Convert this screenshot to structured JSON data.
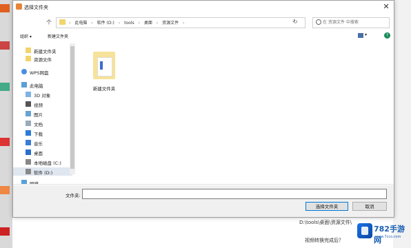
{
  "dialog": {
    "title": "选择文件夹",
    "close_glyph": "✕",
    "nav": {
      "up_glyph": "个",
      "breadcrumbs": [
        "此电脑",
        "软件 (D:)",
        "tools",
        "桌面",
        "资源文件"
      ],
      "separator": "›",
      "dropdown_glyph": "⌄",
      "refresh_glyph": "↻",
      "search_placeholder": "在 资源文件 中搜索"
    },
    "toolbar": {
      "organize_label": "组织 ▾",
      "new_folder_label": "新建文件夹",
      "view_dropdown_glyph": "▾",
      "help_glyph": "?"
    },
    "sidebar": {
      "items": [
        {
          "label": "新建文件夹",
          "icon": "folder-icon"
        },
        {
          "label": "资源文件",
          "icon": "folder-icon"
        },
        {
          "label": "WPS网盘",
          "icon": "cloud-icon"
        },
        {
          "label": "此电脑",
          "icon": "computer-icon"
        },
        {
          "label": "3D 对象",
          "icon": "cube-icon"
        },
        {
          "label": "视频",
          "icon": "video-icon"
        },
        {
          "label": "图片",
          "icon": "image-icon"
        },
        {
          "label": "文档",
          "icon": "document-icon"
        },
        {
          "label": "下载",
          "icon": "download-icon"
        },
        {
          "label": "音乐",
          "icon": "music-icon"
        },
        {
          "label": "桌面",
          "icon": "desktop-icon"
        },
        {
          "label": "本地磁盘 (C:)",
          "icon": "drive-icon"
        },
        {
          "label": "软件 (D:)",
          "icon": "drive-icon"
        },
        {
          "label": "网络",
          "icon": "network-icon"
        }
      ],
      "selected_index": 12
    },
    "content": {
      "items": [
        {
          "name": "新建文件夹",
          "icon": "folder-icon"
        }
      ]
    },
    "footer": {
      "filename_label": "文件夹:",
      "filename_value": "",
      "select_button": "选择文件夹",
      "cancel_button": "取消"
    }
  },
  "background": {
    "path_text": "D:\\tools\\桌面\\资源文件\\",
    "status_text": "视频转换完成后？"
  },
  "watermark": {
    "brand": "782手游网",
    "site": "www.7cco.com"
  },
  "colors": {
    "folder": "#f7e29a",
    "accent": "#0078d7",
    "help": "#1a8c5a",
    "brand": "#1a5fb4"
  }
}
